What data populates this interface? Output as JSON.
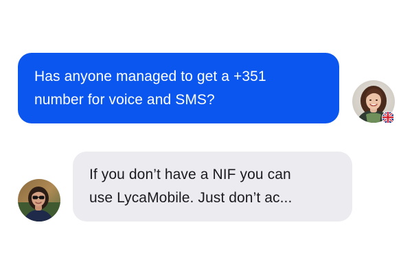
{
  "messages": {
    "outgoing": {
      "line1": "Has anyone managed to get a +351",
      "line2": "number for voice and SMS?"
    },
    "incoming": {
      "line1": "If you don’t have a NIF you can",
      "line2": "use LycaMobile. Just don’t ac..."
    }
  },
  "colors": {
    "outgoing_bubble": "#0a56ee",
    "incoming_bubble": "#ececf0",
    "outgoing_text": "#ffffff",
    "incoming_text": "#1b1b1f"
  },
  "icons": {
    "right_avatar": "woman-avatar",
    "left_avatar": "woman-with-glasses-avatar",
    "flag": "uk-flag-icon"
  }
}
